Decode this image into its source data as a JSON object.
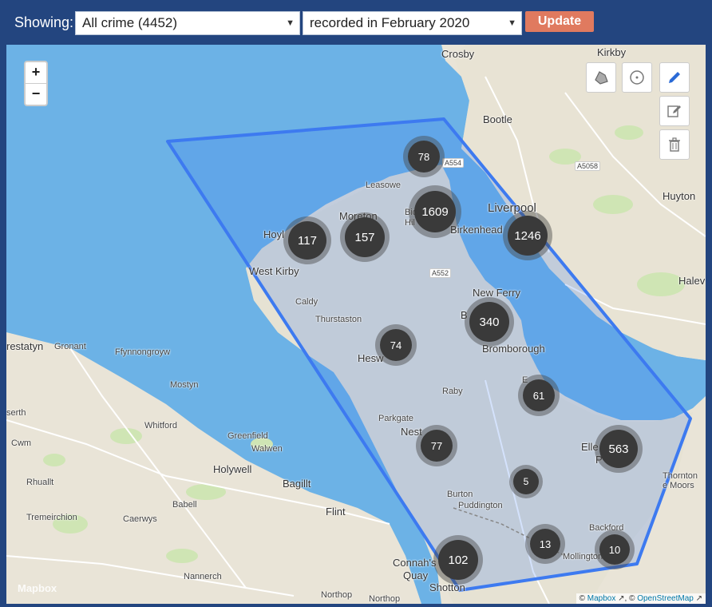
{
  "toolbar": {
    "showing_label": "Showing:",
    "crime_select_value": "All crime (4452)",
    "period_select_value": "recorded in February 2020",
    "update_label": "Update"
  },
  "zoom": {
    "in": "+",
    "out": "−"
  },
  "map": {
    "place_labels": {
      "crosby": "Crosby",
      "kirkby": "Kirkby",
      "bootle": "Bootle",
      "huyton": "Huyton",
      "leasowe": "Leasowe",
      "liverpool": "Liverpool",
      "moreton": "Moreton",
      "birkenhead": "Birkenhead",
      "bidston": "Bids",
      "hilbre": "Hil",
      "hoylake": "Hoyl",
      "west_kirby": "West Kirby",
      "halewood": "Halev",
      "caldy": "Caldy",
      "thurstaston": "Thurstaston",
      "new_ferry": "New Ferry",
      "bebington": "B",
      "bromborough": "Bromborough",
      "heswall": "Hesw",
      "prestatyn": "restatyn",
      "gronant": "Gronant",
      "ffynnongroyw": "Ffynnongroyw",
      "raby": "Raby",
      "eastham": "E",
      "mostyn": "Mostyn",
      "parkgate": "Parkgate",
      "neston": "Nest",
      "serth": "serth",
      "whitford": "Whitford",
      "greenfield": "Greenfield",
      "walwen": "Walwen",
      "ellesmere_port": "Elle",
      "ellesmere_port_2": "P",
      "cwm": "Cwm",
      "holywell": "Holywell",
      "thornton": "Thornton",
      "le_moors": "e Moors",
      "rhuallt": "Rhuallt",
      "bagillt": "Bagillt",
      "burton": "Burton",
      "puddington": "Puddington",
      "babell": "Babell",
      "flint": "Flint",
      "tremeirchion": "Tremeirchion",
      "caerwys": "Caerwys",
      "backford": "Backford",
      "mollington": "Mollington",
      "connahs_quay": "Connah's",
      "connahs_quay_2": "Quay",
      "nannerch": "Nannerch",
      "northop": "Northop",
      "northop_2": "Northop",
      "shotton": "Shotton"
    },
    "road_labels": {
      "a554": "A554",
      "a5058": "A5058",
      "a552": "A552"
    },
    "clusters": [
      {
        "count": "78"
      },
      {
        "count": "1609"
      },
      {
        "count": "117"
      },
      {
        "count": "157"
      },
      {
        "count": "1246"
      },
      {
        "count": "340"
      },
      {
        "count": "74"
      },
      {
        "count": "61"
      },
      {
        "count": "77"
      },
      {
        "count": "563"
      },
      {
        "count": "5"
      },
      {
        "count": "13"
      },
      {
        "count": "102"
      },
      {
        "count": "10"
      }
    ],
    "colors": {
      "water": "#6cb2e6",
      "land": "#e9e4d7",
      "polygon_stroke": "#3d7af0",
      "polygon_fill": "#3d7af0",
      "cluster": "#3a3a3a",
      "toolbar": "#23457f",
      "update_button": "#e07a5f"
    }
  },
  "draw_controls": {
    "polygon_icon": "polygon-draw-icon",
    "circle_icon": "circle-draw-icon",
    "pencil_icon": "pencil-icon",
    "edit_icon": "edit-icon",
    "trash_icon": "trash-icon"
  },
  "attribution": {
    "prefix": "©",
    "mapbox": "Mapbox",
    "separator": "©",
    "osm": "OpenStreetMap"
  },
  "logo": "Mapbox"
}
